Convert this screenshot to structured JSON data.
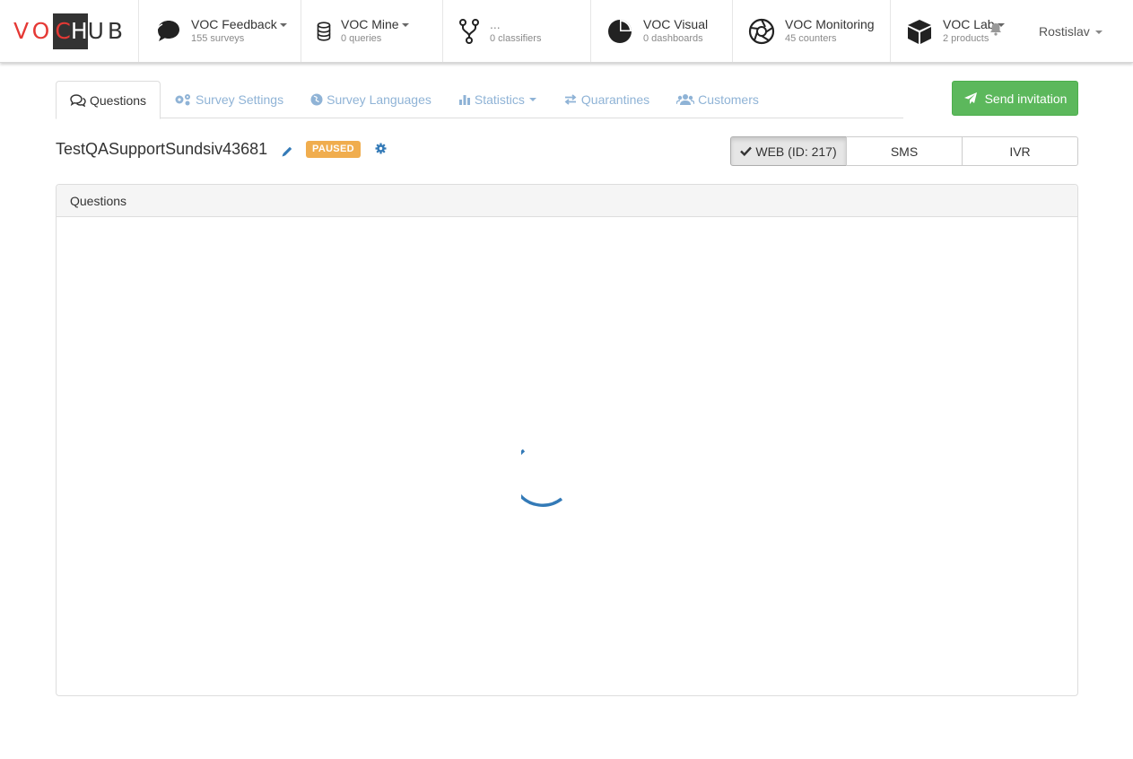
{
  "logo": {
    "part1": "VO",
    "box_c": "C",
    "box_h": "H",
    "tail": "UB"
  },
  "nav": [
    {
      "title": "VOC Feedback",
      "sub": "155 surveys",
      "icon": "speech-bubble-icon"
    },
    {
      "title": "VOC Mine",
      "sub": "0 queries",
      "icon": "database-icon"
    },
    {
      "title": "...",
      "sub": "0 classifiers",
      "icon": "fork-icon"
    },
    {
      "title": "VOC Visual",
      "sub": "0 dashboards",
      "icon": "pie-chart-icon"
    },
    {
      "title": "VOC Monitoring",
      "sub": "45 counters",
      "icon": "aperture-icon"
    },
    {
      "title": "VOC Lab",
      "sub": "2 products",
      "icon": "cube-icon"
    }
  ],
  "user": {
    "name": "Rostislav"
  },
  "tabs": [
    {
      "label": "Questions"
    },
    {
      "label": "Survey Settings"
    },
    {
      "label": "Survey Languages"
    },
    {
      "label": "Statistics"
    },
    {
      "label": "Quarantines"
    },
    {
      "label": "Customers"
    }
  ],
  "send_invitation": "Send invitation",
  "survey": {
    "title": "TestQASupportSundsiv43681",
    "status": "PAUSED"
  },
  "channels": {
    "web": "WEB (ID: 217)",
    "sms": "SMS",
    "ivr": "IVR"
  },
  "panel": {
    "heading": "Questions"
  },
  "colors": {
    "accent": "#337ab7",
    "success": "#5cb85c",
    "warning": "#f0ad4e",
    "logo_red": "#e53935",
    "tab_link": "#8fb3d6"
  }
}
